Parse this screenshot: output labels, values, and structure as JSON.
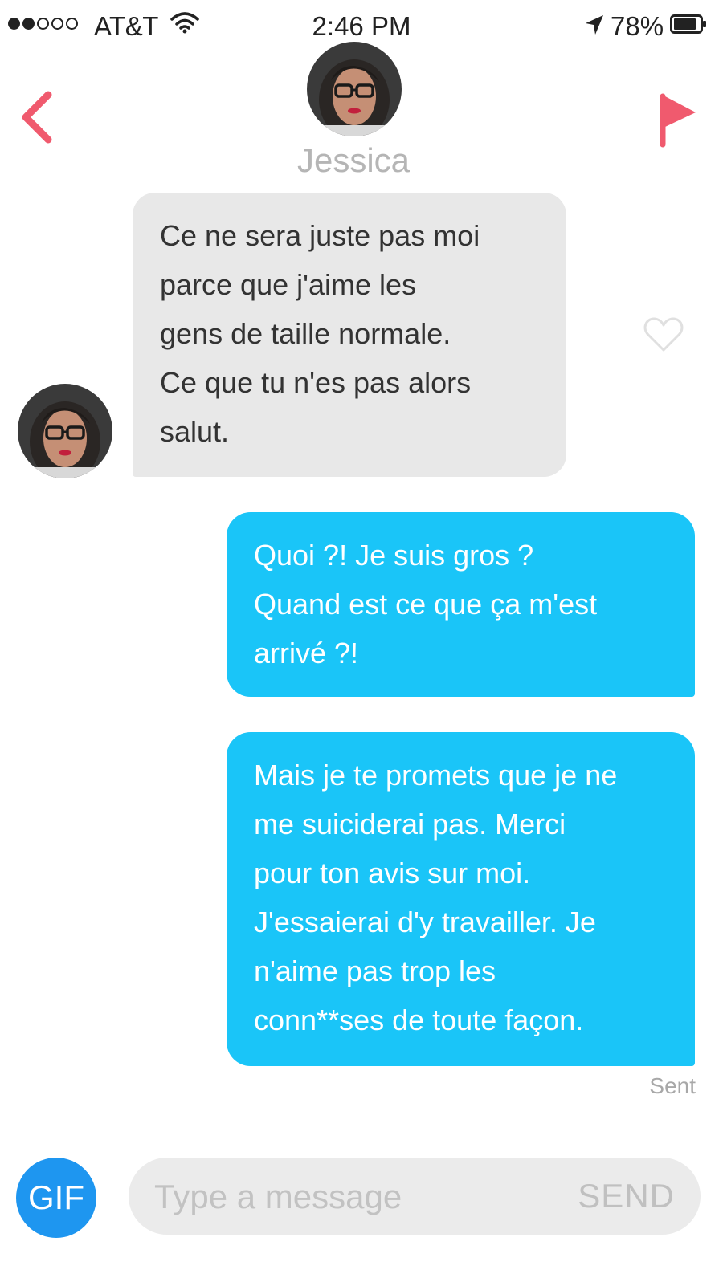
{
  "status_bar": {
    "carrier": "AT&T",
    "time": "2:46 PM",
    "battery": "78%",
    "signal_bars_filled": 2,
    "signal_bars_total": 5,
    "icons": [
      "wifi-icon",
      "location-arrow-icon",
      "battery-icon"
    ]
  },
  "header": {
    "contact_name": "Jessica",
    "back_icon": "chevron-left-icon",
    "report_icon": "flag-icon",
    "accent_color": "#f05a6e"
  },
  "messages": [
    {
      "direction": "received",
      "text": "Ce ne sera juste pas moi\nparce  que j'aime les\ngens de taille normale.\nCe que tu n'es pas alors\nsalut."
    },
    {
      "direction": "sent",
      "text": "Quoi ?! Je suis gros ?\nQuand est ce que ça m'est\narrivé ?!"
    },
    {
      "direction": "sent",
      "text": "Mais je te promets que je ne\nme suiciderai pas. Merci\npour ton avis sur moi.\nJ'essaierai d'y travailler. Je\nn'aime pas trop les\nconn**ses de toute façon."
    }
  ],
  "sent_status": "Sent",
  "composer": {
    "gif_label": "GIF",
    "placeholder": "Type a message",
    "send_label": "SEND"
  },
  "colors": {
    "received_bubble": "#e8e8e8",
    "sent_bubble": "#1ac5f8",
    "gif_button": "#1e96f0"
  }
}
